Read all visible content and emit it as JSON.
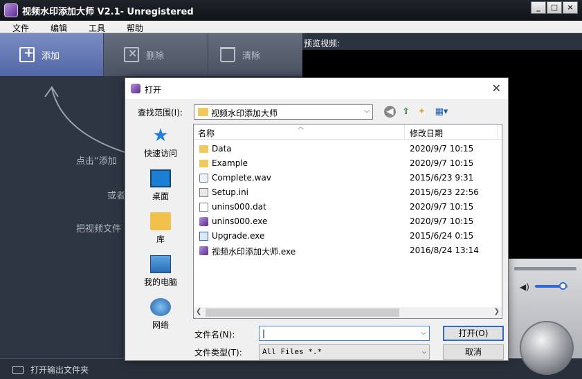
{
  "app": {
    "title": "视频水印添加大师 V2.1- Unregistered",
    "window_buttons": [
      "_",
      "□",
      "×"
    ]
  },
  "menu": [
    "文件",
    "编辑",
    "工具",
    "帮助"
  ],
  "toolbar": {
    "add_label": "添加",
    "delete_label": "删除",
    "clear_label": "清除"
  },
  "left_panel": {
    "hint_line1": "点击“添加",
    "hint_line2": "或者",
    "hint_line3": "把视频文件"
  },
  "bottom": {
    "open_output_label": "打开输出文件夹"
  },
  "preview": {
    "label": "预览视频:",
    "volume_level": 0.85
  },
  "dialog": {
    "title": "打开",
    "look_in_label": "查找范围(I):",
    "look_in_value": "视频水印添加大师",
    "places": [
      "快速访问",
      "桌面",
      "库",
      "我的电脑",
      "网络"
    ],
    "columns": {
      "name": "名称",
      "date": "修改日期"
    },
    "files": [
      {
        "name": "Data",
        "date": "2020/9/7 10:15",
        "type": "folder"
      },
      {
        "name": "Example",
        "date": "2020/9/7 10:15",
        "type": "folder"
      },
      {
        "name": "Complete.wav",
        "date": "2015/6/23 9:31",
        "type": "wav"
      },
      {
        "name": "Setup.ini",
        "date": "2015/6/23 22:56",
        "type": "cfg"
      },
      {
        "name": "unins000.dat",
        "date": "2020/9/7 10:15",
        "type": "doc"
      },
      {
        "name": "unins000.exe",
        "date": "2020/9/7 10:15",
        "type": "app"
      },
      {
        "name": "Upgrade.exe",
        "date": "2015/6/24 0:15",
        "type": "win"
      },
      {
        "name": "视频水印添加大师.exe",
        "date": "2016/8/24 13:14",
        "type": "app"
      }
    ],
    "filename_label": "文件名(N):",
    "filename_value": "|",
    "filetype_label": "文件类型(T):",
    "filetype_value": "All Files *.*",
    "open_button": "打开(O)",
    "cancel_button": "取消"
  }
}
